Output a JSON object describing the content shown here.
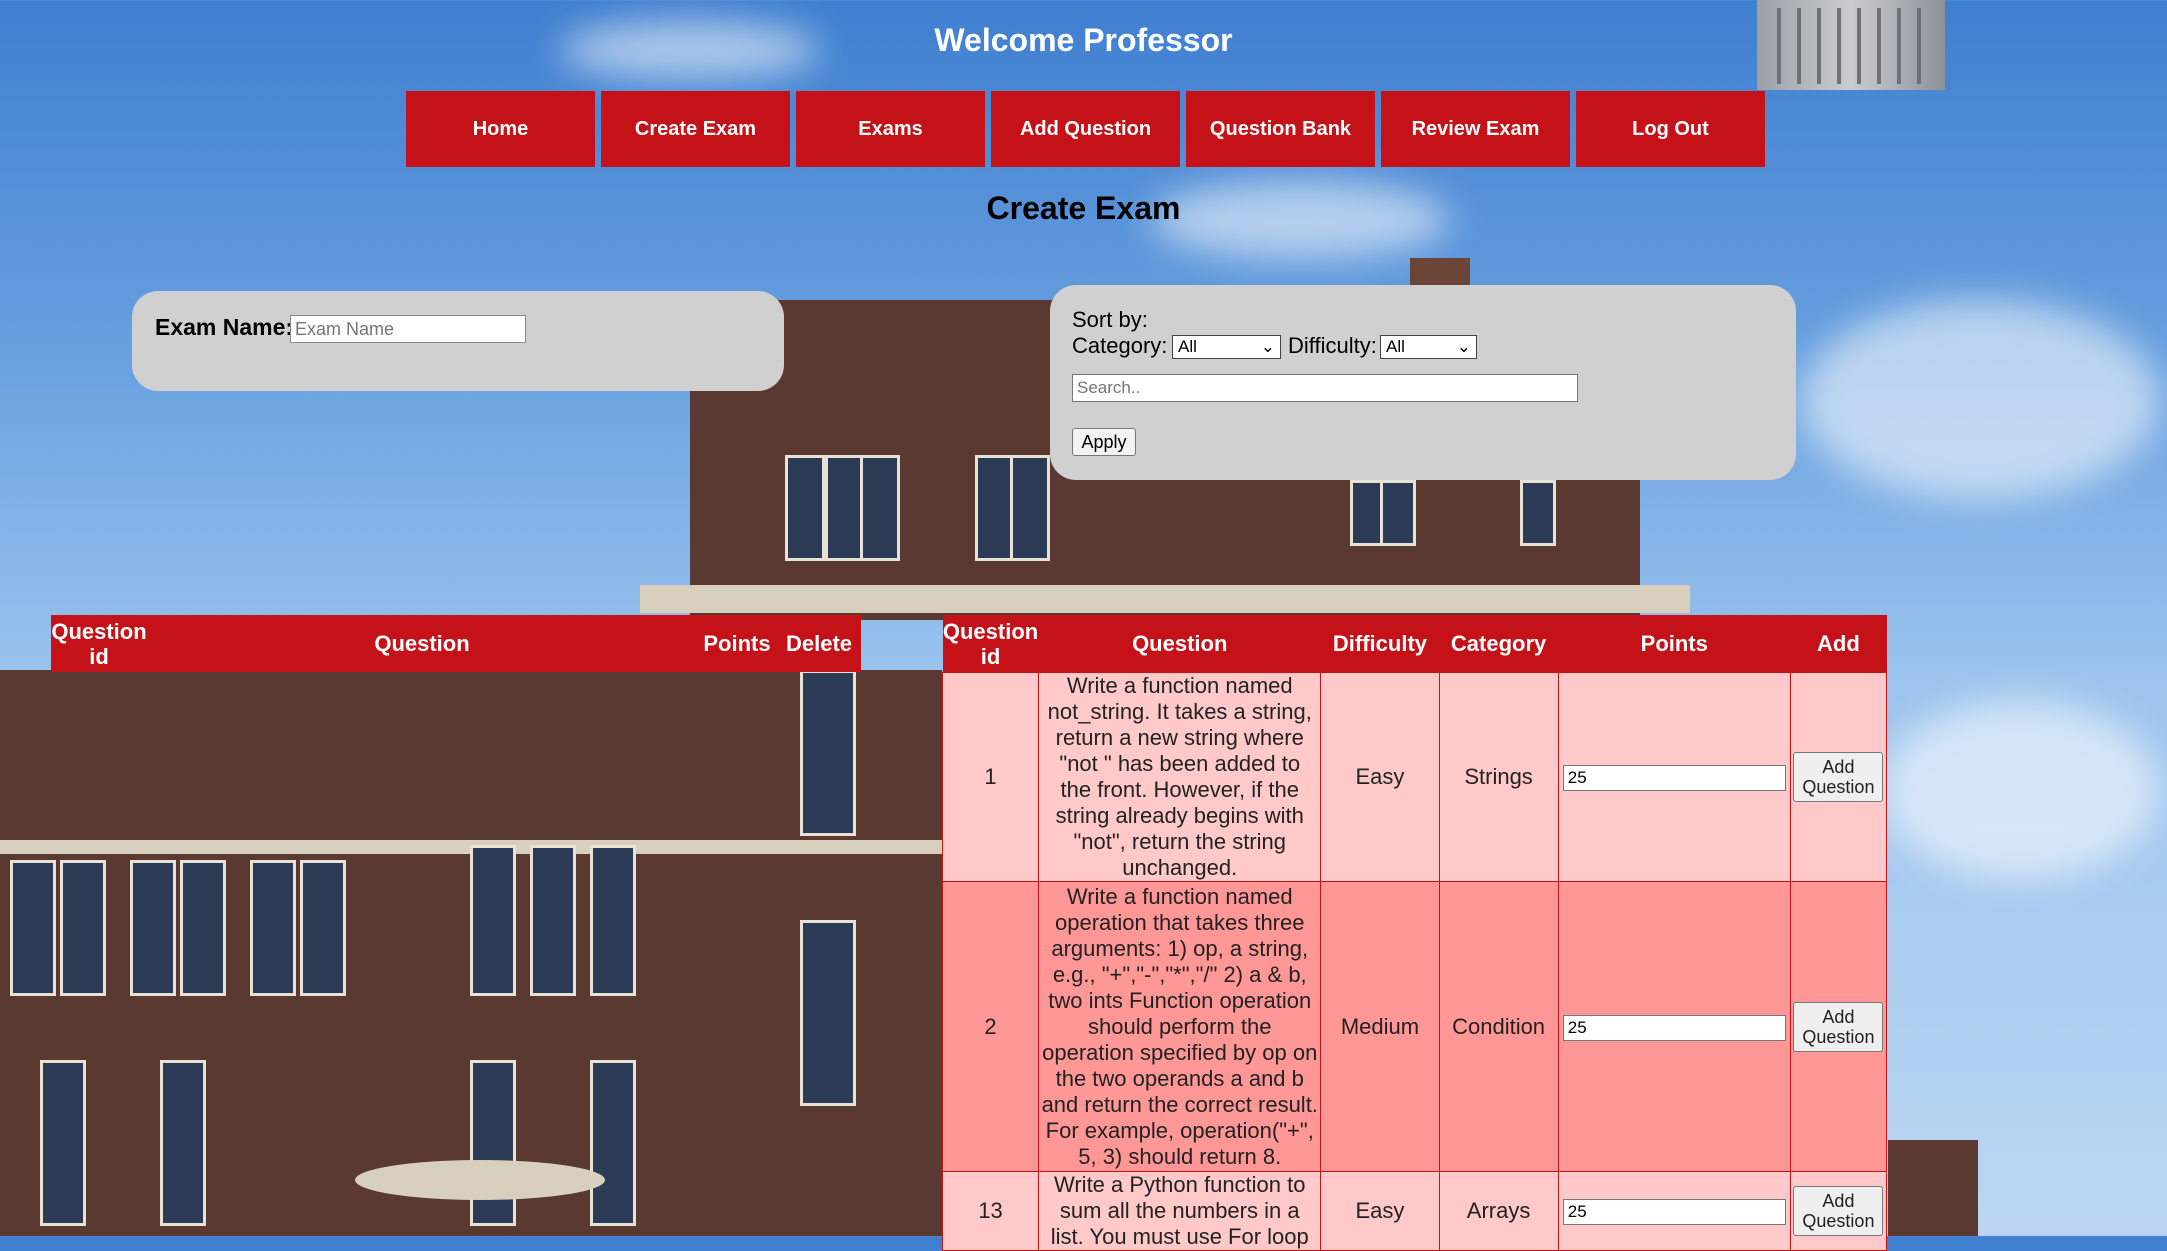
{
  "header": {
    "title": "Welcome Professor"
  },
  "nav": {
    "items": [
      "Home",
      "Create Exam",
      "Exams",
      "Add Question",
      "Question Bank",
      "Review Exam",
      "Log Out"
    ]
  },
  "page_title": "Create Exam",
  "exam_form": {
    "label": "Exam Name:",
    "placeholder": "Exam Name",
    "value": ""
  },
  "filters": {
    "sort_label": "Sort by:",
    "category_label": "Category:",
    "category_value": "All",
    "difficulty_label": "Difficulty:",
    "difficulty_value": "All",
    "search_placeholder": "Search..",
    "apply_label": "Apply"
  },
  "selected_table": {
    "headers": [
      "Question id",
      "Question",
      "Points",
      "Delete"
    ],
    "rows": []
  },
  "bank_table": {
    "headers": [
      "Question id",
      "Question",
      "Difficulty",
      "Category",
      "Points",
      "Add"
    ],
    "add_label": "Add Question",
    "rows": [
      {
        "id": "1",
        "question": "Write a function named not_string. It takes a string, return a new string where \"not \" has been added to the front. However, if the string already begins with \"not\", return the string unchanged.",
        "difficulty": "Easy",
        "category": "Strings",
        "points": "25"
      },
      {
        "id": "2",
        "question": "Write a function named operation that takes three arguments: 1) op, a string, e.g., \"+\",\"-\",\"*\",\"/\" 2) a & b, two ints Function operation should perform the operation specified by op on the two operands a and b and return the correct result. For example, operation(\"+\", 5, 3) should return 8.",
        "difficulty": "Medium",
        "category": "Condition",
        "points": "25"
      },
      {
        "id": "13",
        "question": "Write a Python function to sum all the numbers in a list. You must use For loop",
        "difficulty": "Easy",
        "category": "Arrays",
        "points": "25"
      }
    ]
  }
}
